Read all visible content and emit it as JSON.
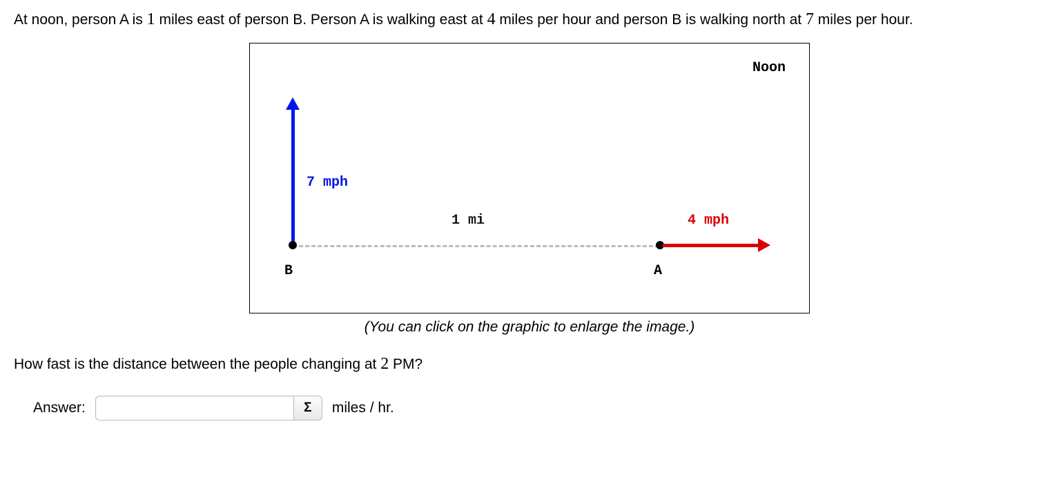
{
  "problem": {
    "text_before": "At noon, person A is ",
    "dist": "1",
    "text_mid1": " miles east of person B. Person A is walking east at ",
    "speedA": "4",
    "text_mid2": " miles per hour and person B is walking north at ",
    "speedB": "7",
    "text_end": " miles per hour."
  },
  "figure": {
    "noon": "Noon",
    "mi": "1 mi",
    "mphB": "7 mph",
    "mphA": "4 mph",
    "B": "B",
    "A": "A"
  },
  "caption": "(You can click on the graphic to enlarge the image.)",
  "question": {
    "before": "How fast is the distance between the people changing at ",
    "time": "2",
    "after": " PM?"
  },
  "answer": {
    "label": "Answer:",
    "value": "",
    "sigma": "Σ",
    "units": "miles / hr."
  },
  "chart_data": {
    "type": "diagram",
    "title": "Noon",
    "points": [
      {
        "name": "B",
        "x": 0,
        "y": 0
      },
      {
        "name": "A",
        "x": 1,
        "y": 0
      }
    ],
    "vectors": [
      {
        "from": "B",
        "direction": "north",
        "magnitude_mph": 7,
        "color": "#0015ea"
      },
      {
        "from": "A",
        "direction": "east",
        "magnitude_mph": 4,
        "color": "#db0004"
      }
    ],
    "distance_AB_mi": 1
  }
}
